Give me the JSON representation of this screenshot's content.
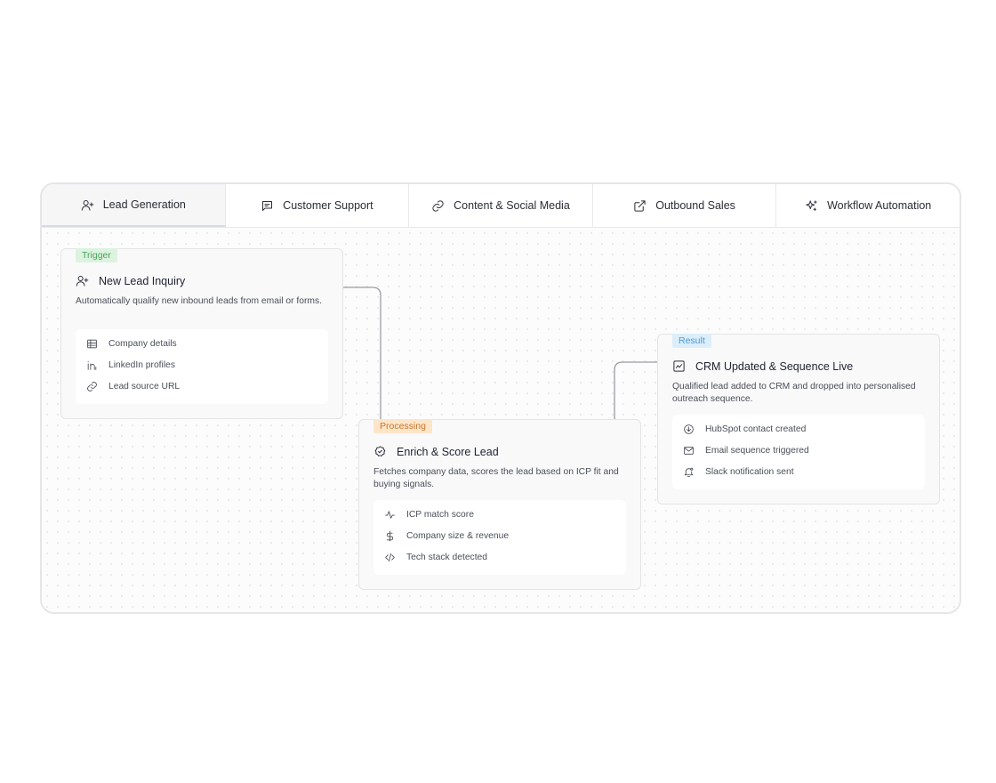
{
  "tabs": [
    {
      "label": "Lead Generation",
      "icon": "user-plus-icon",
      "active": true
    },
    {
      "label": "Customer Support",
      "icon": "chat-icon",
      "active": false
    },
    {
      "label": "Content & Social Media",
      "icon": "link-icon",
      "active": false
    },
    {
      "label": "Outbound Sales",
      "icon": "external-link-icon",
      "active": false
    },
    {
      "label": "Workflow Automation",
      "icon": "sparkles-icon",
      "active": false
    }
  ],
  "cards": {
    "trigger": {
      "badge": "Trigger",
      "title": "New Lead Inquiry",
      "icon": "user-plus-icon",
      "description": "Automatically qualify new inbound leads from email or forms.",
      "items": [
        {
          "label": "Company details",
          "icon": "table-icon"
        },
        {
          "label": "LinkedIn profiles",
          "icon": "linkedin-icon"
        },
        {
          "label": "Lead source URL",
          "icon": "link-icon"
        }
      ]
    },
    "processing": {
      "badge": "Processing",
      "title": "Enrich & Score Lead",
      "icon": "badge-check-icon",
      "description": "Fetches company data, scores the lead based on ICP fit and buying signals.",
      "items": [
        {
          "label": "ICP match score",
          "icon": "activity-icon"
        },
        {
          "label": "Company size & revenue",
          "icon": "dollar-icon"
        },
        {
          "label": "Tech stack detected",
          "icon": "code-icon"
        }
      ]
    },
    "result": {
      "badge": "Result",
      "title": "CRM Updated & Sequence Live",
      "icon": "chart-icon",
      "description": "Qualified lead added to CRM and dropped into personalised outreach sequence.",
      "items": [
        {
          "label": "HubSpot contact created",
          "icon": "download-circle-icon"
        },
        {
          "label": "Email sequence triggered",
          "icon": "mail-icon"
        },
        {
          "label": "Slack notification sent",
          "icon": "bell-icon"
        }
      ]
    }
  },
  "colors": {
    "trigger_badge": "#4aa35a",
    "processing_badge": "#c7772a",
    "result_badge": "#4b9bd1",
    "connector": "#9a9ca3"
  }
}
